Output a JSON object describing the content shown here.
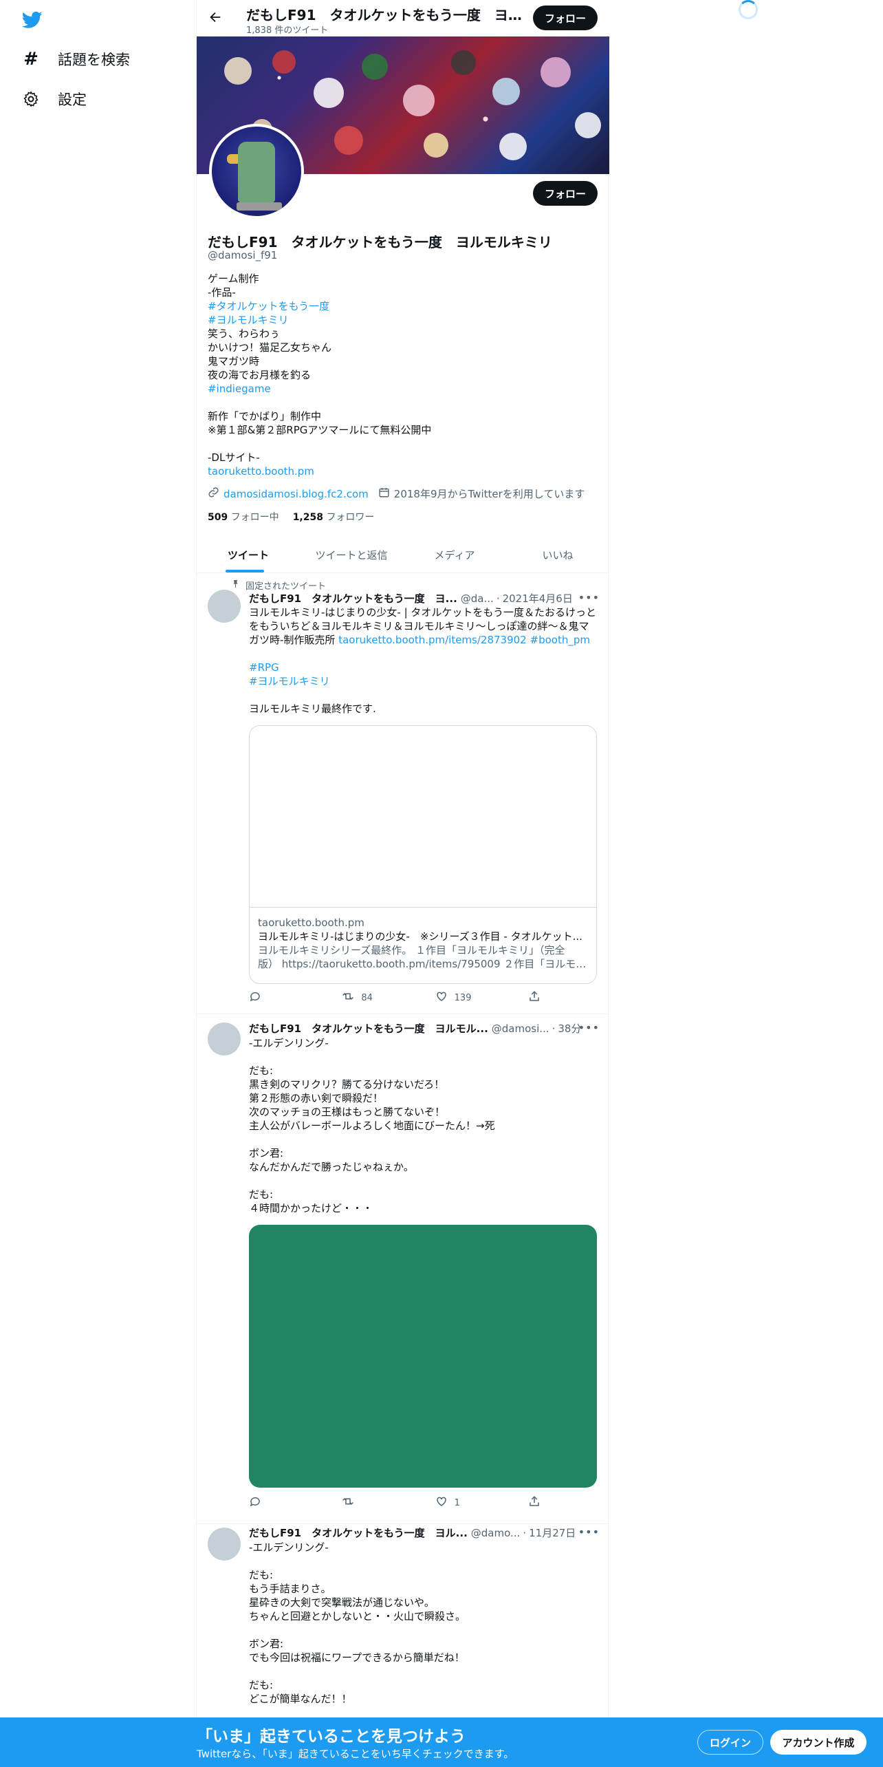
{
  "nav": {
    "explore_label": "話題を検索",
    "settings_label": "設定"
  },
  "header": {
    "name": "だもしF91　タオルケットをもう一度　ヨルモルキミリ",
    "tweet_count": "1,838 件のツイート",
    "follow_label": "フォロー"
  },
  "profile": {
    "name": "だもしF91　タオルケットをもう一度　ヨルモルキミリ",
    "handle": "@damosi_f91",
    "follow_label": "フォロー",
    "bio": [
      {
        "text": "ゲーム制作",
        "link": false
      },
      {
        "text": "-作品-",
        "link": false
      },
      {
        "text": "#タオルケットをもう一度",
        "link": true
      },
      {
        "text": "#ヨルモルキミリ",
        "link": true
      },
      {
        "text": "笑う、わらわぅ",
        "link": false
      },
      {
        "text": "かいけつ！猫足乙女ちゃん",
        "link": false
      },
      {
        "text": "鬼マガツ時",
        "link": false
      },
      {
        "text": "夜の海でお月様を釣る",
        "link": false
      },
      {
        "text": "#indiegame",
        "link": true
      },
      {
        "text": "",
        "link": false
      },
      {
        "text": "新作「でかばり」制作中",
        "link": false
      },
      {
        "text": "※第１部&第２部RPGアツマールにて無料公開中",
        "link": false
      },
      {
        "text": "",
        "link": false
      },
      {
        "text": "-DLサイト-",
        "link": false
      },
      {
        "text": "taoruketto.booth.pm",
        "link": true
      }
    ],
    "website": "damosidamosi.blog.fc2.com",
    "joined": "2018年9月からTwitterを利用しています",
    "following_count": "509",
    "following_label": "フォロー中",
    "followers_count": "1,258",
    "followers_label": "フォロワー"
  },
  "tabs": [
    "ツイート",
    "ツイートと返信",
    "メディア",
    "いいね"
  ],
  "tweets": [
    {
      "pinned_label": "固定されたツイート",
      "name": "だもしF91　タオルケットをもう一度　ヨ...",
      "handle": "@da...",
      "time": "2021年4月6日",
      "lines": [
        [
          {
            "t": "ヨルモルキミリ-はじまりの少女- | タオルケットをもう一度＆たおるけっと",
            "l": false
          }
        ],
        [
          {
            "t": "をもういちど＆ヨルモルキミリ＆ヨルモルキミリ～しっぽ達の絆～＆鬼マ",
            "l": false
          }
        ],
        [
          {
            "t": "ガツ時-制作販売所 ",
            "l": false
          },
          {
            "t": "taoruketto.booth.pm/items/2873902",
            "l": true
          },
          {
            "t": " ",
            "l": false
          },
          {
            "t": "#booth_pm",
            "l": true
          }
        ],
        [
          {
            "t": "",
            "l": false
          }
        ],
        [
          {
            "t": "#RPG",
            "l": true
          }
        ],
        [
          {
            "t": "#ヨルモルキミリ",
            "l": true
          }
        ],
        [
          {
            "t": "",
            "l": false
          }
        ],
        [
          {
            "t": "ヨルモルキミリ最終作です.",
            "l": false
          }
        ]
      ],
      "card": {
        "domain": "taoruketto.booth.pm",
        "title": "ヨルモルキミリ-はじまりの少女-　※シリーズ３作目 - タオルケット...",
        "desc1": "ヨルモルキミリシリーズ最終作。 １作目「ヨルモルキミリ」（完全",
        "desc2": "版） https://taoruketto.booth.pm/items/795009 ２作目「ヨルモルキミ..."
      },
      "replies": "",
      "retweets": "84",
      "likes": "139"
    },
    {
      "name": "だもしF91　タオルケットをもう一度　ヨルモル...",
      "handle": "@damosi...",
      "time": "38分",
      "lines": [
        "-エルデンリング-",
        "",
        "だも:",
        "黒き剣のマリクリ？勝てる分けないだろ！",
        "第２形態の赤い剣で瞬殺だ！",
        "次のマッチョの王様はもっと勝てないぞ！",
        "主人公がバレーボールよろしく地面にびーたん！→死",
        "",
        "ボン君:",
        "なんだかんだで勝ったじゃねぇか。",
        "",
        "だも:",
        "４時間かかったけど・・・"
      ],
      "replies": "",
      "retweets": "",
      "likes": "1"
    },
    {
      "name": "だもしF91　タオルケットをもう一度　ヨル...",
      "handle": "@damo...",
      "time": "11月27日",
      "lines": [
        "-エルデンリング-",
        "",
        "だも:",
        "もう手詰まりさ。",
        "星砕きの大剣で突撃戦法が通じないや。",
        "ちゃんと回避とかしないと・・火山で瞬殺さ。",
        "",
        "ボン君:",
        "でも今回は祝福にワープできるから簡単だね！",
        "",
        "だも:",
        "どこが簡単なんだ！！"
      ]
    }
  ],
  "bottom_bar": {
    "title": "「いま」起きていることを見つけよう",
    "subtitle": "Twitterなら、「いま」起きていることをいち早くチェックできます。",
    "login_label": "ログイン",
    "signup_label": "アカウント作成"
  },
  "colors": {
    "accent": "#1d9bf0",
    "dark_button": "#0f1419",
    "media_green": "#218462"
  }
}
